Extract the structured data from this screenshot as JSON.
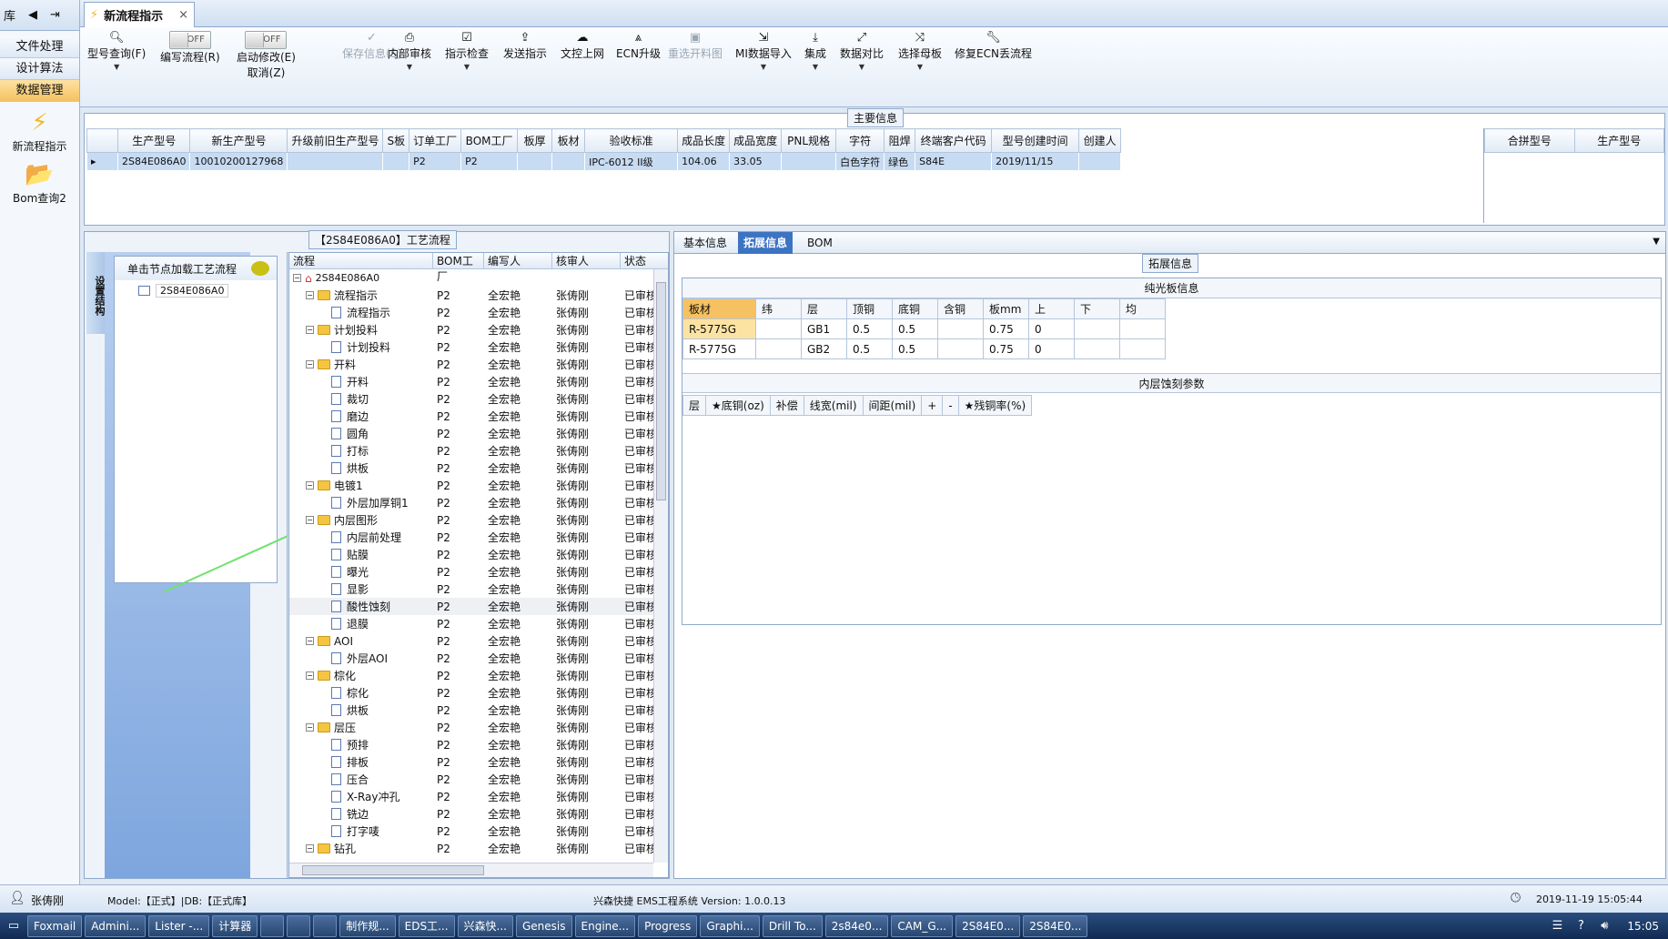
{
  "left_nav": {
    "title": "库",
    "buttons": [
      "文件处理",
      "设计算法",
      "数据管理"
    ],
    "active_index": 2,
    "icons": [
      {
        "label": "新流程指示",
        "icon": "lightning-icon"
      },
      {
        "label": "Bom查询2",
        "icon": "folder-icon"
      }
    ]
  },
  "tab": {
    "title": "新流程指示",
    "close": "×"
  },
  "ribbon": {
    "buttons": [
      {
        "label": "型号查询(F)",
        "icon": "search-icon",
        "caret": true,
        "disabled": false
      },
      {
        "label": "编写流程(R)",
        "toggle": "OFF"
      },
      {
        "label": "启动修改(E)",
        "label2": "取消(Z)",
        "toggle": "OFF"
      },
      {
        "label": "保存信息(S)",
        "icon": "check-icon",
        "disabled": true
      },
      {
        "label": "内部审核",
        "icon": "print-icon",
        "caret": true
      },
      {
        "label": "指示检查",
        "icon": "checkbox-icon",
        "caret": true
      },
      {
        "label": "发送指示",
        "icon": "upload-icon"
      },
      {
        "label": "文控上网",
        "icon": "cloud-icon"
      },
      {
        "label": "ECN升级",
        "icon": "ecn-icon"
      },
      {
        "label": "重选开料图",
        "icon": "image-icon",
        "disabled": true
      },
      {
        "label": "MI数据导入",
        "icon": "import-icon",
        "caret": true
      },
      {
        "label": "集成",
        "icon": "download-icon",
        "caret": true
      },
      {
        "label": "数据对比",
        "icon": "compare-icon",
        "caret": true
      },
      {
        "label": "选择母板",
        "icon": "shuffle-icon",
        "caret": true
      },
      {
        "label": "修复ECN丢流程",
        "icon": "wrench-icon"
      }
    ]
  },
  "main_info": {
    "title": "主要信息",
    "columns": [
      "生产型号",
      "新生产型号",
      "升级前旧生产型号",
      "S板",
      "订单工厂",
      "BOM工厂",
      "板厚",
      "板材",
      "验收标准",
      "成品长度",
      "成品宽度",
      "PNL规格",
      "字符",
      "阻焊",
      "终端客户代码",
      "型号创建时间",
      "创建人"
    ],
    "row": [
      "2S84E086A0",
      "10010200127968",
      "",
      "",
      "P2",
      "P2",
      "",
      "",
      "IPC-6012 II级",
      "104.06",
      "33.05",
      "",
      "白色字符",
      "绿色",
      "S84E",
      "2019/11/15",
      ""
    ],
    "merge_columns": [
      "合拼型号",
      "生产型号"
    ]
  },
  "process": {
    "title": "【2S84E086A0】工艺流程",
    "side_tab": "设置结构",
    "hint": "单击节点加载工艺流程",
    "left_node": "2S84E086A0",
    "columns": [
      "流程",
      "BOM工厂",
      "编写人",
      "核审人",
      "状态"
    ],
    "root": "2S84E086A0",
    "rows": [
      {
        "name": "流程指示",
        "folder": true
      },
      {
        "name": "流程指示"
      },
      {
        "name": "计划投料",
        "folder": true
      },
      {
        "name": "计划投料"
      },
      {
        "name": "开料",
        "folder": true
      },
      {
        "name": "开料"
      },
      {
        "name": "裁切"
      },
      {
        "name": "磨边"
      },
      {
        "name": "圆角"
      },
      {
        "name": "打标"
      },
      {
        "name": "烘板"
      },
      {
        "name": "电镀1",
        "folder": true
      },
      {
        "name": "外层加厚铜1"
      },
      {
        "name": "内层图形",
        "folder": true
      },
      {
        "name": "内层前处理"
      },
      {
        "name": "贴膜"
      },
      {
        "name": "曝光"
      },
      {
        "name": "显影"
      },
      {
        "name": "酸性蚀刻"
      },
      {
        "name": "退膜"
      },
      {
        "name": "AOI",
        "folder": true
      },
      {
        "name": "外层AOI"
      },
      {
        "name": "棕化",
        "folder": true
      },
      {
        "name": "棕化"
      },
      {
        "name": "烘板"
      },
      {
        "name": "层压",
        "folder": true
      },
      {
        "name": "预排"
      },
      {
        "name": "排板"
      },
      {
        "name": "压合"
      },
      {
        "name": "X-Ray冲孔"
      },
      {
        "name": "铣边"
      },
      {
        "name": "打字唛"
      },
      {
        "name": "钻孔",
        "folder": true
      }
    ],
    "bom": "P2",
    "writer": "全宏艳",
    "reviewer": "张俦刚",
    "status": "已审核"
  },
  "detail": {
    "tabs": [
      "基本信息",
      "拓展信息",
      "BOM"
    ],
    "active_tab": 1,
    "group_title": "拓展信息",
    "plain_board": {
      "title": "纯光板信息",
      "columns": [
        "板材",
        "纬",
        "层",
        "顶铜",
        "底铜",
        "含铜",
        "板mm",
        "上",
        "下",
        "均"
      ],
      "rows": [
        [
          "R-5775G",
          "",
          "GB1",
          "0.5",
          "0.5",
          "",
          "0.75",
          "0",
          ""
        ],
        [
          "R-5775G",
          "",
          "GB2",
          "0.5",
          "0.5",
          "",
          "0.75",
          "0",
          ""
        ]
      ]
    },
    "inner_etch": {
      "title": "内层蚀刻参数",
      "columns": [
        "层",
        "★底铜(oz)",
        "补偿",
        "线宽(mil)",
        "间距(mil)",
        "+",
        "-",
        "★残铜率(%)"
      ]
    }
  },
  "status": {
    "user": "张俦刚",
    "model": "Model:【正式】|DB:【正式库】",
    "system": "兴森快捷 EMS工程系统 Version: 1.0.0.13",
    "datetime": "2019-11-19 15:05:44"
  },
  "taskbar": {
    "items": [
      "Foxmail",
      "Admini...",
      "Lister -...",
      "计算器",
      "",
      "",
      "",
      "制作规...",
      "EDS工...",
      "兴森快...",
      "Genesis",
      "Engine...",
      "Progress",
      "Graphi...",
      "Drill To...",
      "2s84e0...",
      "CAM_G...",
      "2S84E0...",
      "2S84E0..."
    ],
    "clock": "15:05"
  },
  "colors": {
    "accent": "#f6c160",
    "selection": "#c7dbf2",
    "header_bg": "#e1eaf5"
  }
}
